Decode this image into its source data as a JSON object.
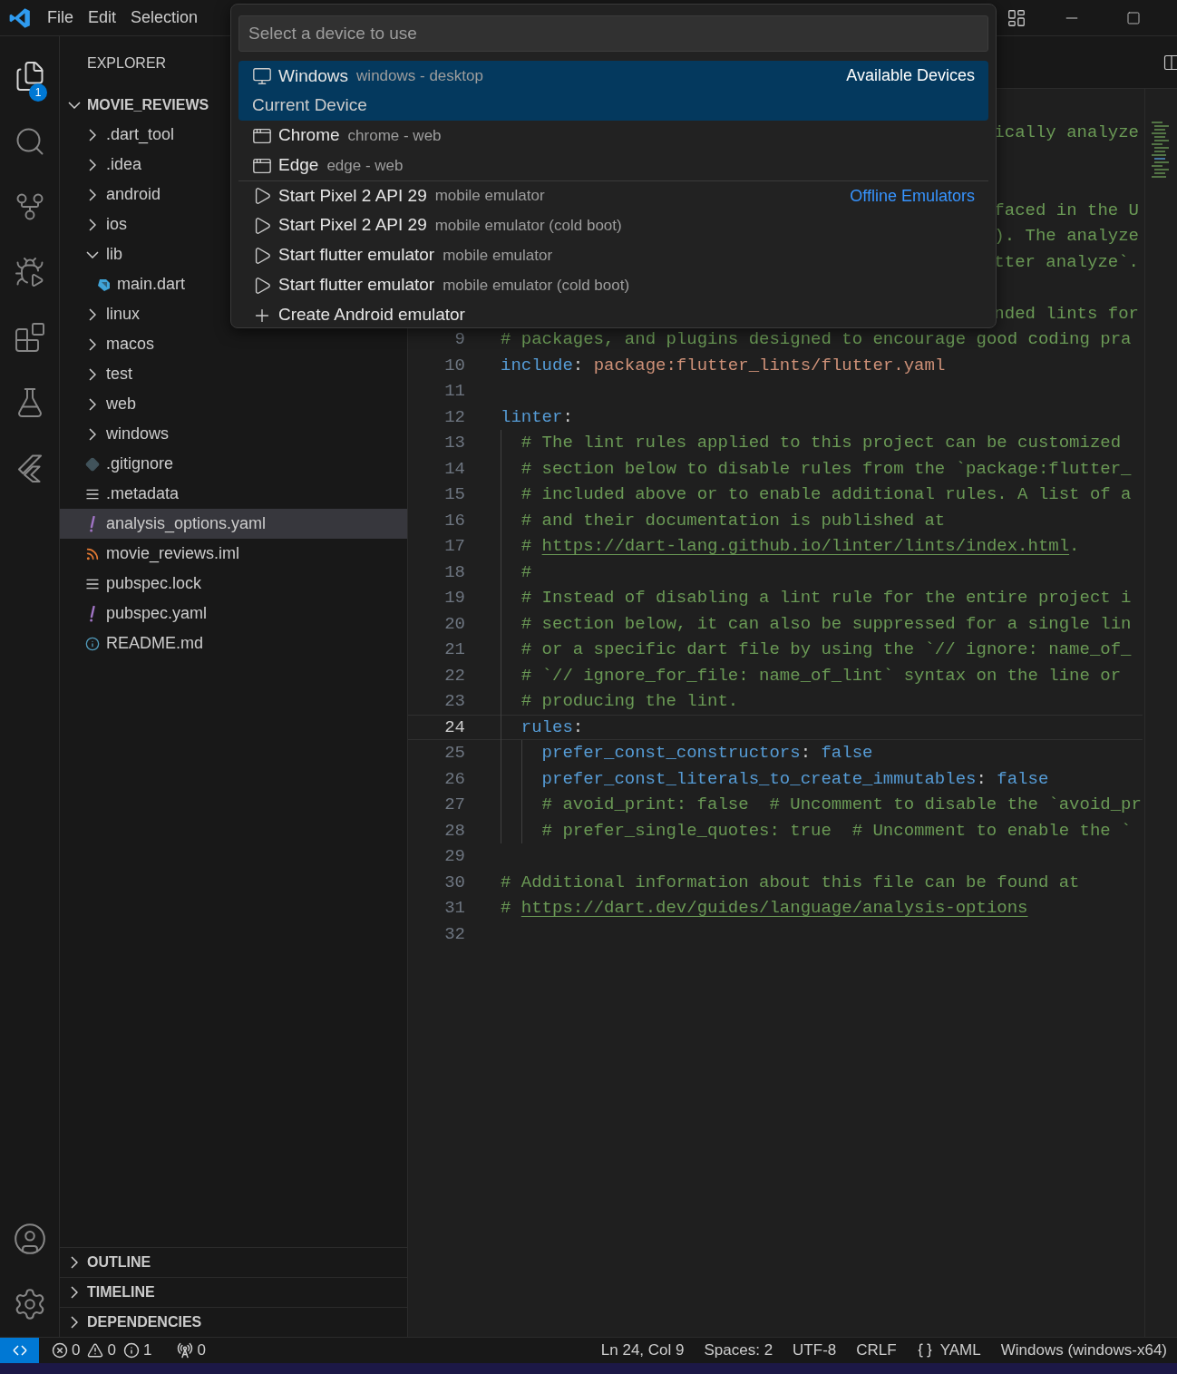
{
  "menu": [
    "File",
    "Edit",
    "Selection"
  ],
  "activity": {
    "items": [
      {
        "selected": true,
        "badge": "1"
      },
      {
        "selected": false
      },
      {
        "selected": false
      },
      {
        "selected": false
      },
      {
        "selected": false
      },
      {
        "selected": false
      },
      {
        "selected": false
      }
    ]
  },
  "explorer": {
    "title": "EXPLORER",
    "root": {
      "label": "MOVIE_REVIEWS",
      "expanded": true,
      "children": [
        {
          "label": ".dart_tool",
          "kind": "folder",
          "expanded": false,
          "selected": false
        },
        {
          "label": ".idea",
          "kind": "folder",
          "expanded": false,
          "selected": false
        },
        {
          "label": "android",
          "kind": "folder",
          "expanded": false,
          "selected": false
        },
        {
          "label": "ios",
          "kind": "folder",
          "expanded": false,
          "selected": false
        },
        {
          "label": "lib",
          "kind": "folder",
          "expanded": true,
          "selected": false,
          "children": [
            {
              "label": "main.dart",
              "kind": "dart",
              "selected": false
            }
          ]
        },
        {
          "label": "linux",
          "kind": "folder",
          "expanded": false,
          "selected": false
        },
        {
          "label": "macos",
          "kind": "folder",
          "expanded": false,
          "selected": false
        },
        {
          "label": "test",
          "kind": "folder",
          "expanded": false,
          "selected": false
        },
        {
          "label": "web",
          "kind": "folder",
          "expanded": false,
          "selected": false
        },
        {
          "label": "windows",
          "kind": "folder",
          "expanded": false,
          "selected": false
        },
        {
          "label": ".gitignore",
          "kind": "git",
          "selected": false
        },
        {
          "label": ".metadata",
          "kind": "text",
          "selected": false
        },
        {
          "label": "analysis_options.yaml",
          "kind": "yaml",
          "selected": true
        },
        {
          "label": "movie_reviews.iml",
          "kind": "xml",
          "selected": false
        },
        {
          "label": "pubspec.lock",
          "kind": "text",
          "selected": false
        },
        {
          "label": "pubspec.yaml",
          "kind": "yaml",
          "selected": false
        },
        {
          "label": "README.md",
          "kind": "info",
          "selected": false
        }
      ]
    },
    "panels": [
      {
        "label": "OUTLINE",
        "expanded": false
      },
      {
        "label": "TIMELINE",
        "expanded": false
      },
      {
        "label": "DEPENDENCIES",
        "expanded": false
      }
    ]
  },
  "editor": {
    "covered_lines": [
      {
        "kind": "text",
        "tail": "ically analyze"
      },
      {
        "kind": "blank"
      },
      {
        "kind": "blank"
      },
      {
        "kind": "text",
        "tail": "faced in the U"
      },
      {
        "kind": "text",
        "tail": "). The analyze"
      },
      {
        "kind": "text",
        "tail": "tter analyze`."
      },
      {
        "kind": "blank"
      },
      {
        "kind": "text",
        "tail": "nded lints for"
      }
    ],
    "lines": [
      {
        "number": "9",
        "current": false,
        "segments": [
          {
            "text": "# packages, and plugins designed to encourage good coding pra",
            "kind": "comment"
          }
        ]
      },
      {
        "number": "10",
        "current": false,
        "segments": [
          {
            "text": "include",
            "kind": "key"
          },
          {
            "text": ": ",
            "kind": "punct"
          },
          {
            "text": "package:flutter_lints/flutter.yaml",
            "kind": "value"
          }
        ]
      },
      {
        "number": "11",
        "current": false
      },
      {
        "number": "12",
        "current": false,
        "segments": [
          {
            "text": "linter",
            "kind": "key"
          },
          {
            "text": ":",
            "kind": "punct"
          }
        ]
      },
      {
        "number": "13",
        "current": false,
        "segments": [
          {
            "text": "  # The lint rules applied to this project can be customized",
            "kind": "comment"
          }
        ]
      },
      {
        "number": "14",
        "current": false,
        "segments": [
          {
            "text": "  # section below to disable rules from the `package:flutter_",
            "kind": "comment"
          }
        ]
      },
      {
        "number": "15",
        "current": false,
        "segments": [
          {
            "text": "  # included above or to enable additional rules. A list of a",
            "kind": "comment"
          }
        ]
      },
      {
        "number": "16",
        "current": false,
        "segments": [
          {
            "text": "  # and their documentation is published at",
            "kind": "comment"
          }
        ]
      },
      {
        "number": "17",
        "current": false,
        "segments": [
          {
            "text": "  # ",
            "kind": "comment"
          },
          {
            "text": "https://dart-lang.github.io/linter/lints/index.html",
            "kind": "link"
          },
          {
            "text": ".",
            "kind": "comment"
          }
        ]
      },
      {
        "number": "18",
        "current": false,
        "segments": [
          {
            "text": "  #",
            "kind": "comment"
          }
        ]
      },
      {
        "number": "19",
        "current": false,
        "segments": [
          {
            "text": "  # Instead of disabling a lint rule for the entire project i",
            "kind": "comment"
          }
        ]
      },
      {
        "number": "20",
        "current": false,
        "segments": [
          {
            "text": "  # section below, it can also be suppressed for a single lin",
            "kind": "comment"
          }
        ]
      },
      {
        "number": "21",
        "current": false,
        "segments": [
          {
            "text": "  # or a specific dart file by using the `// ignore: name_of_",
            "kind": "comment"
          }
        ]
      },
      {
        "number": "22",
        "current": false,
        "segments": [
          {
            "text": "  # `// ignore_for_file: name_of_lint` syntax on the line or",
            "kind": "comment"
          }
        ]
      },
      {
        "number": "23",
        "current": false,
        "segments": [
          {
            "text": "  # producing the lint.",
            "kind": "comment"
          }
        ]
      },
      {
        "number": "24",
        "current": true,
        "segments": [
          {
            "text": "  rules",
            "kind": "key"
          },
          {
            "text": ":",
            "kind": "punct"
          }
        ]
      },
      {
        "number": "25",
        "current": false,
        "segments": [
          {
            "text": "    prefer_const_constructors",
            "kind": "key"
          },
          {
            "text": ": ",
            "kind": "punct"
          },
          {
            "text": "false",
            "kind": "bool"
          }
        ]
      },
      {
        "number": "26",
        "current": false,
        "segments": [
          {
            "text": "    prefer_const_literals_to_create_immutables",
            "kind": "key"
          },
          {
            "text": ": ",
            "kind": "punct"
          },
          {
            "text": "false",
            "kind": "bool"
          }
        ]
      },
      {
        "number": "27",
        "current": false,
        "segments": [
          {
            "text": "    # avoid_print: false  # Uncomment to disable the `avoid_pr",
            "kind": "comment"
          }
        ]
      },
      {
        "number": "28",
        "current": false,
        "segments": [
          {
            "text": "    # prefer_single_quotes: true  # Uncomment to enable the `",
            "kind": "comment"
          }
        ]
      },
      {
        "number": "29",
        "current": false
      },
      {
        "number": "30",
        "current": false,
        "segments": [
          {
            "text": "# Additional information about this file can be found at",
            "kind": "comment"
          }
        ]
      },
      {
        "number": "31",
        "current": false,
        "segments": [
          {
            "text": "# ",
            "kind": "comment"
          },
          {
            "text": "https://dart.dev/guides/language/analysis-options",
            "kind": "link"
          }
        ]
      },
      {
        "number": "32",
        "current": false
      }
    ]
  },
  "picker": {
    "placeholder": "Select a device to use",
    "items": [
      {
        "kind": "desktop",
        "label": "Windows",
        "detail": "windows - desktop",
        "group": "Available Devices",
        "description": "Current Device",
        "selected": true
      },
      {
        "kind": "browser",
        "label": "Chrome",
        "detail": "chrome - web",
        "selected": false
      },
      {
        "kind": "browser",
        "label": "Edge",
        "detail": "edge - web",
        "selected": false
      },
      {
        "kind": "emulator",
        "label": "Start Pixel 2 API 29",
        "detail": "mobile emulator",
        "group": "Offline Emulators",
        "selected": false
      },
      {
        "kind": "emulator",
        "label": "Start Pixel 2 API 29",
        "detail": "mobile emulator (cold boot)",
        "selected": false
      },
      {
        "kind": "emulator",
        "label": "Start flutter emulator",
        "detail": "mobile emulator",
        "selected": false
      },
      {
        "kind": "emulator",
        "label": "Start flutter emulator",
        "detail": "mobile emulator (cold boot)",
        "selected": false
      },
      {
        "kind": "create",
        "label": "Create Android emulator",
        "selected": false
      }
    ]
  },
  "status_bar": {
    "problems": [
      {
        "kind": "error",
        "count": "0"
      },
      {
        "kind": "warning",
        "count": "0"
      },
      {
        "kind": "info",
        "count": "1"
      }
    ],
    "ports": "0",
    "right": [
      {
        "kind": "text",
        "text": "Ln 24, Col 9"
      },
      {
        "kind": "text",
        "text": "Spaces: 2"
      },
      {
        "kind": "text",
        "text": "UTF-8"
      },
      {
        "kind": "text",
        "text": "CRLF"
      },
      {
        "kind": "language",
        "text": "YAML"
      },
      {
        "kind": "text",
        "text": "Windows (windows-x64)"
      }
    ]
  }
}
